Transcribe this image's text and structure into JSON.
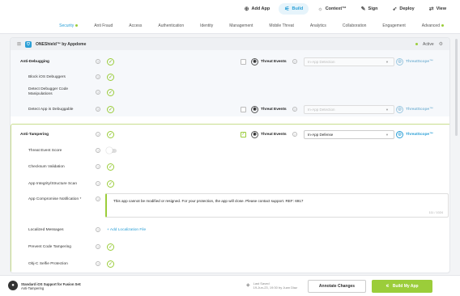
{
  "topbar": {
    "items": [
      {
        "icon": "plus-circle-icon",
        "label": "Add App"
      },
      {
        "icon": "sliders-icon",
        "label": "Build",
        "active": true
      },
      {
        "icon": "bulb-icon",
        "label": "Context™"
      },
      {
        "icon": "pen-icon",
        "label": "Sign"
      },
      {
        "icon": "rocket-icon",
        "label": "Deploy"
      },
      {
        "icon": "arrows-icon",
        "label": "View"
      }
    ]
  },
  "tabs": [
    {
      "label": "Security",
      "active": true,
      "dot": true
    },
    {
      "label": "Anti Fraud"
    },
    {
      "label": "Access"
    },
    {
      "label": "Authentication"
    },
    {
      "label": "Identity"
    },
    {
      "label": "Management"
    },
    {
      "label": "Mobile Threat"
    },
    {
      "label": "Analytics"
    },
    {
      "label": "Collaboration"
    },
    {
      "label": "Engagement"
    },
    {
      "label": "Advanced",
      "dot": true
    }
  ],
  "panel": {
    "title": "ONEShield™ by Appdome",
    "status": "Active"
  },
  "rows": {
    "anti_debugging": {
      "label": "Anti-Debugging",
      "threat_events": "Threat Events",
      "select_placeholder": "In-App Detection",
      "threatscope": "ThreatScope™"
    },
    "block_ios": {
      "label": "Block iOS Debuggers"
    },
    "detect_code_manip": {
      "label": "Detect Debugger Code Manipulations"
    },
    "detect_debuggable": {
      "label": "Detect App is Debuggable",
      "threat_events": "Threat Events",
      "select_placeholder": "In-App Detection",
      "threatscope": "ThreatScope™"
    },
    "anti_tampering": {
      "label": "Anti-Tampering",
      "threat_events": "Threat Events",
      "select_value": "In-App Defense",
      "threatscope": "ThreatScope™"
    },
    "threat_score": {
      "label": "Threat Event Score",
      "toggle": "off"
    },
    "checksum": {
      "label": "Checksum Validation"
    },
    "integrity": {
      "label": "App Integrity/Structure Scan"
    },
    "notification": {
      "label": "App Compromise Notification *",
      "message": "This app cannot be modified or resigned. For your protection, the app will close. Please contact support. REF: 6917",
      "count": "111 / 1024"
    },
    "localized": {
      "label": "Localized Messages",
      "add_link": "Add Localization File"
    },
    "prevent_tampering": {
      "label": "Prevent Code Tampering"
    },
    "objc": {
      "label": "Obj-C Selfie Protection"
    }
  },
  "footer": {
    "title": "Standard iOS Support for Fusion Set:",
    "subtitle": "Anti-Tampering",
    "saved_label": "Last Saved",
    "saved_time": "19-Jun-23, 19:30 by Juan Diaz",
    "annotate_label": "Annotate Changes",
    "build_label": "Build My App"
  },
  "colors": {
    "accent": "#2a9fd6",
    "green": "#9bcd3a"
  }
}
